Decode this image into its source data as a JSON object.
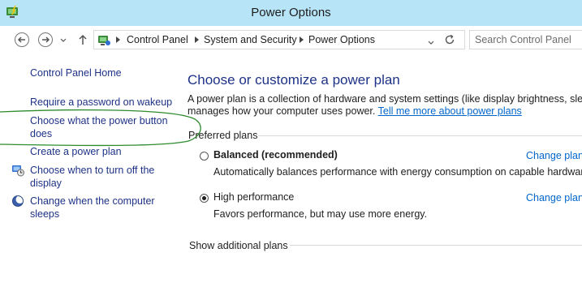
{
  "window": {
    "title": "Power Options"
  },
  "nav": {
    "back_icon": "back-arrow-icon",
    "forward_icon": "forward-arrow-icon",
    "recent_icon": "chevron-down-icon",
    "up_icon": "up-arrow-icon",
    "refresh_icon": "refresh-icon"
  },
  "breadcrumb": {
    "items": [
      "Control Panel",
      "System and Security",
      "Power Options"
    ]
  },
  "search": {
    "placeholder": "Search Control Panel"
  },
  "sidebar": {
    "home": "Control Panel Home",
    "items": [
      {
        "label": "Require a password on wakeup"
      },
      {
        "label_line1": "Choose what the power button",
        "label_line2": "does"
      },
      {
        "label": "Create a power plan"
      },
      {
        "label_line1": "Choose when to turn off the",
        "label_line2": "display"
      },
      {
        "label_line1": "Change when the computer",
        "label_line2": "sleeps"
      }
    ]
  },
  "main": {
    "heading": "Choose or customize a power plan",
    "description_line1": "A power plan is a collection of hardware and system settings (like display brightness, sleep, e",
    "description_line2": "manages how your computer uses power.",
    "learn_more": "Tell me more about power plans",
    "preferred_label": "Preferred plans",
    "plans": [
      {
        "name": "Balanced (recommended)",
        "description": "Automatically balances performance with energy consumption on capable hardware.",
        "change": "Change plan",
        "selected": false
      },
      {
        "name": "High performance",
        "description": "Favors performance, but may use more energy.",
        "change": "Change plan",
        "selected": true
      }
    ],
    "show_additional": "Show additional plans"
  },
  "colors": {
    "titlebar": "#b8e4f8",
    "link": "#0066cc",
    "heading": "#1e3287",
    "annotation": "#2e8b2e"
  }
}
